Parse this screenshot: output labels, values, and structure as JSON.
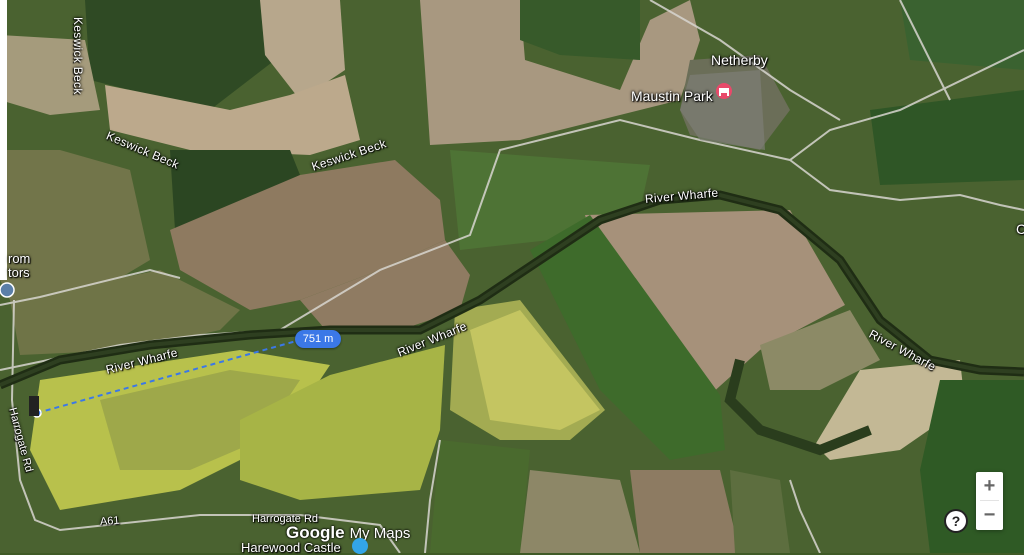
{
  "map": {
    "places": {
      "netherby": "Netherby",
      "maustin_park": "Maustin Park",
      "chap_partial": "Chap",
      "from_partial": "rom",
      "tors_partial": "tors",
      "harewood_castle": "Harewood Castle"
    },
    "waterways": {
      "keswick_beck_1": "Keswick Beck",
      "keswick_beck_2": "Keswick Beck",
      "river_wharfe_1": "River Wharfe",
      "river_wharfe_2": "River Wharfe",
      "river_wharfe_3": "River Wharfe",
      "river_wharfe_4": "River Wharfe"
    },
    "roads": {
      "harrogate_rd_vertical": "Harrogate Rd",
      "harrogate_rd_bottom": "Harrogate Rd",
      "a61": "A61"
    },
    "measurement": {
      "distance_label": "751 m"
    },
    "icons": {
      "hotel_pin": "hotel-pin-icon",
      "castle_marker": "castle-icon"
    },
    "colors": {
      "measure_line": "#3b78e7",
      "hotel_pin": "#e8496a"
    }
  },
  "controls": {
    "zoom_in_label": "+",
    "zoom_out_label": "−",
    "help_label": "?"
  },
  "branding": {
    "google_label": "Google",
    "mymaps_label": "My Maps"
  }
}
